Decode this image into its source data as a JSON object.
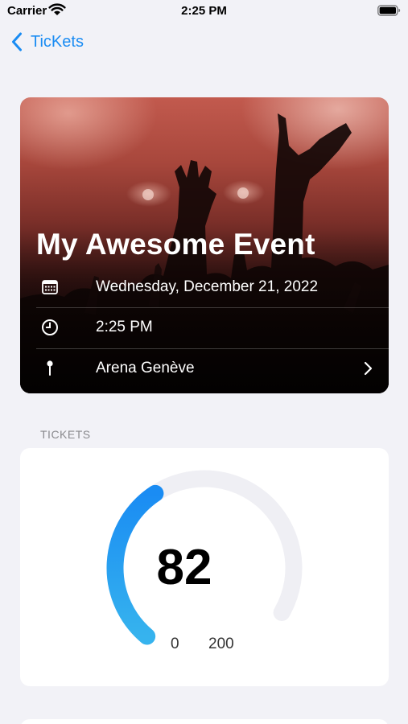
{
  "status_bar": {
    "carrier": "Carrier",
    "time": "2:25 PM"
  },
  "nav": {
    "back_label": "TicKets"
  },
  "event": {
    "title": "My Awesome Event",
    "date": "Wednesday, December 21, 2022",
    "time": "2:25 PM",
    "location": "Arena Genève"
  },
  "tickets": {
    "section_title": "TICKETS",
    "value": 82,
    "min_label": "0",
    "max_label": "200",
    "min": 0,
    "max": 200,
    "colors": {
      "fill_start": "#1a8cf3",
      "fill_end": "#36b3ee",
      "track": "#efeff4"
    }
  },
  "colors": {
    "accent": "#1a8cf3",
    "background": "#f2f2f7"
  }
}
